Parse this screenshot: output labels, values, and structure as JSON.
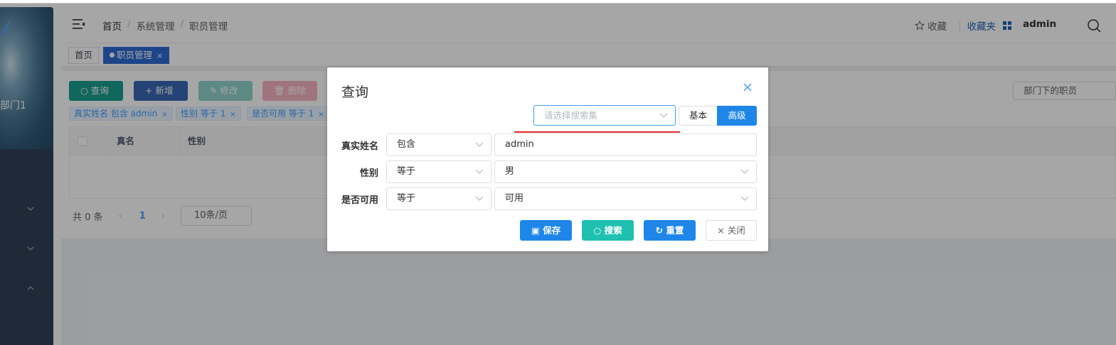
{
  "sidebar": {
    "dept_label": "部门1"
  },
  "navbar": {
    "breadcrumb": [
      "首页",
      "系统管理",
      "职员管理"
    ],
    "fav_label": "收藏",
    "favbox_label": "收藏夹",
    "user": "admin"
  },
  "tags": {
    "home": "首页",
    "active": "职员管理"
  },
  "toolbar": {
    "query": "查询",
    "add": "新增",
    "edit": "修改",
    "delete": "删除"
  },
  "filters": [
    "真实姓名 包含 admin",
    "性别 等于 1",
    "是否可用 等于 1"
  ],
  "dept_select": "部门下的职员",
  "table": {
    "columns": [
      "真名",
      "性别"
    ]
  },
  "pager": {
    "total": "共 0 条",
    "page": "1",
    "size": "10条/页"
  },
  "dialog": {
    "title": "查询",
    "search_set_placeholder": "请选择搜索集",
    "mode_basic": "基本",
    "mode_advanced": "高级",
    "rows": [
      {
        "label": "真实姓名",
        "op": "包含",
        "value": "admin"
      },
      {
        "label": "性别",
        "op": "等于",
        "value": "男"
      },
      {
        "label": "是否可用",
        "op": "等于",
        "value": "可用"
      }
    ],
    "buttons": {
      "save": "保存",
      "search": "搜索",
      "reset": "重置",
      "close": "关闭"
    }
  },
  "colors": {
    "primary": "#1e86e9",
    "success": "#1fc0b0",
    "query_btn": "#1b9f8f",
    "add_btn": "#3866b3",
    "sidebar": "#304156"
  }
}
